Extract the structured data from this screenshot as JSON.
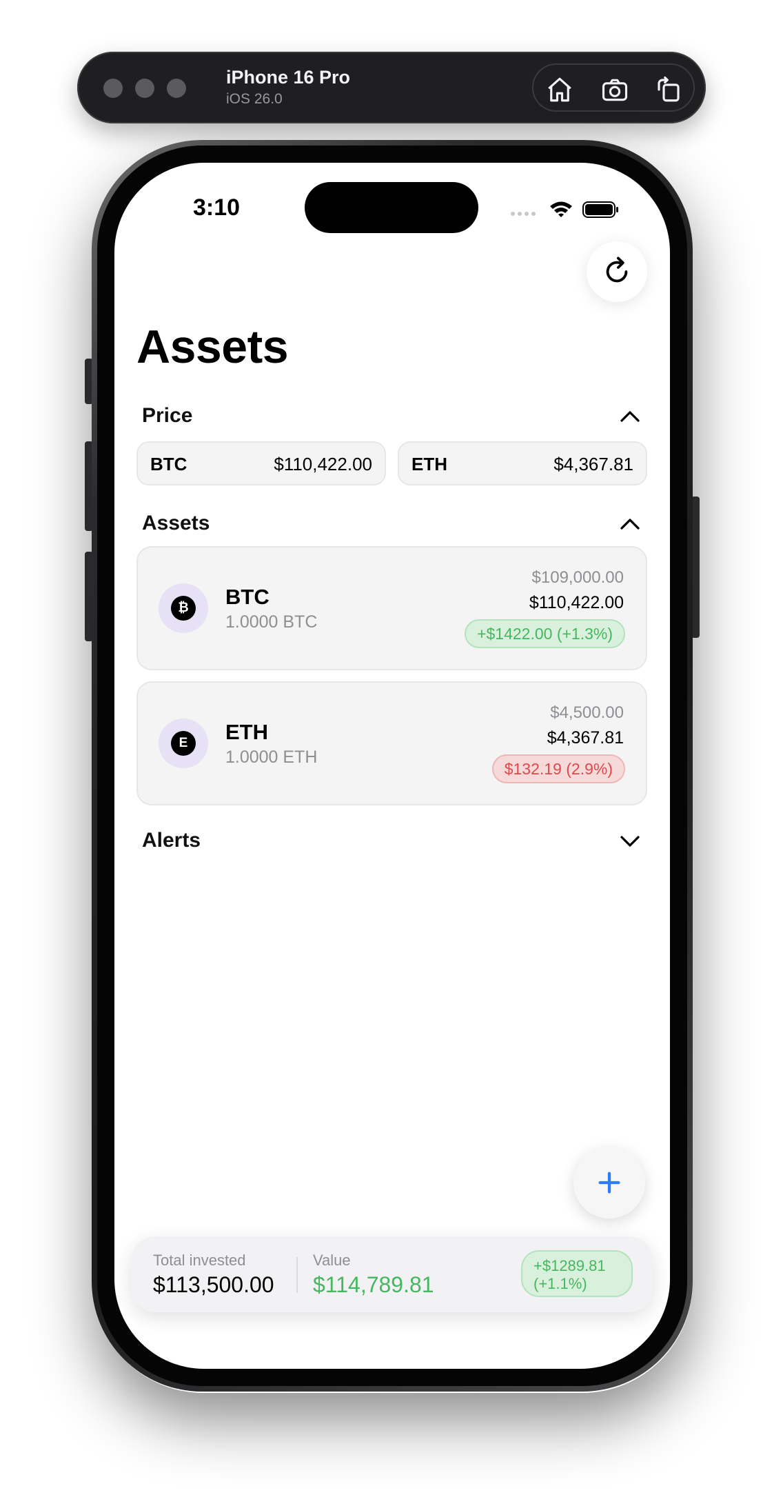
{
  "simulator": {
    "device_name": "iPhone 16 Pro",
    "os_version": "iOS 26.0",
    "tools": [
      {
        "icon": "home-icon"
      },
      {
        "icon": "screenshot-icon"
      },
      {
        "icon": "rotate-icon"
      }
    ]
  },
  "status_bar": {
    "time": "3:10"
  },
  "page": {
    "title": "Assets"
  },
  "sections": {
    "price": {
      "label": "Price",
      "expanded": true
    },
    "assets": {
      "label": "Assets",
      "expanded": true
    },
    "alerts": {
      "label": "Alerts",
      "expanded": false
    }
  },
  "prices": [
    {
      "symbol": "BTC",
      "price": "$110,422.00"
    },
    {
      "symbol": "ETH",
      "price": "$4,367.81"
    }
  ],
  "assets": [
    {
      "symbol": "BTC",
      "icon_glyph": "₿",
      "quantity": "1.0000 BTC",
      "cost": "$109,000.00",
      "current": "$110,422.00",
      "change": "+$1422.00 (+1.3%)",
      "change_type": "gain"
    },
    {
      "symbol": "ETH",
      "icon_glyph": "E",
      "quantity": "1.0000 ETH",
      "cost": "$4,500.00",
      "current": "$4,367.81",
      "change": "$132.19 (2.9%)",
      "change_type": "loss"
    }
  ],
  "summary": {
    "invested_label": "Total invested",
    "invested_value": "$113,500.00",
    "value_label": "Value",
    "value_value": "$114,789.81",
    "change_line1": "+$1289.81",
    "change_line2": "(+1.1%)"
  },
  "colors": {
    "gain": "#47b660",
    "loss": "#e2484b",
    "accent": "#2f7cf6",
    "coin_ring": "#e6e1f4"
  }
}
